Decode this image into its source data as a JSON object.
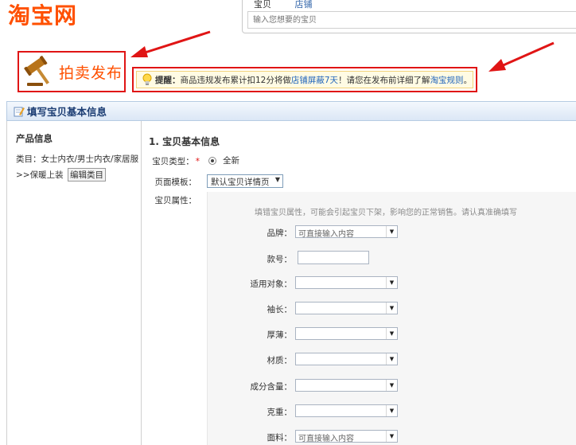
{
  "header": {
    "logo_text": "淘宝网",
    "search_tabs": [
      "宝贝",
      "店铺"
    ],
    "search_placeholder": "输入您想要的宝贝"
  },
  "auction": {
    "title": "拍卖发布"
  },
  "notice": {
    "label": "提醒：",
    "text_1": "商品违规发布累计扣12分将做",
    "link_1": "店铺屏蔽7天",
    "text_2": "！请您在发布前详细了解",
    "link_2": "淘宝规则",
    "text_3": "。"
  },
  "section": {
    "title": "填写宝贝基本信息"
  },
  "left_panel": {
    "title": "产品信息",
    "category": "类目：女士内衣/男士内衣/家居服",
    "path": ">>保暖上装",
    "edit_button": "编辑类目"
  },
  "form": {
    "step_title": "1. 宝贝基本信息",
    "type_label": "宝贝类型：",
    "type_required": "*",
    "type_value": "全新",
    "template_label": "页面模板：",
    "template_value": "默认宝贝详情页",
    "attr_label": "宝贝属性：",
    "attr_hint": "填错宝贝属性，可能会引起宝贝下架，影响您的正常销售。请认真准确填写",
    "attributes": [
      {
        "label": "品牌：",
        "kind": "select",
        "value": "可直接输入内容"
      },
      {
        "label": "款号：",
        "kind": "input",
        "value": ""
      },
      {
        "label": "适用对象：",
        "kind": "select",
        "value": ""
      },
      {
        "label": "袖长：",
        "kind": "select",
        "value": ""
      },
      {
        "label": "厚薄：",
        "kind": "select",
        "value": ""
      },
      {
        "label": "材质：",
        "kind": "select",
        "value": ""
      },
      {
        "label": "成分含量：",
        "kind": "select",
        "value": ""
      },
      {
        "label": "克重：",
        "kind": "select",
        "value": ""
      },
      {
        "label": "面料：",
        "kind": "select",
        "value": "可直接输入内容"
      }
    ]
  },
  "colors": {
    "brand_orange": "#ff5000",
    "highlight_red": "#e01515",
    "link_blue": "#2266bb"
  }
}
